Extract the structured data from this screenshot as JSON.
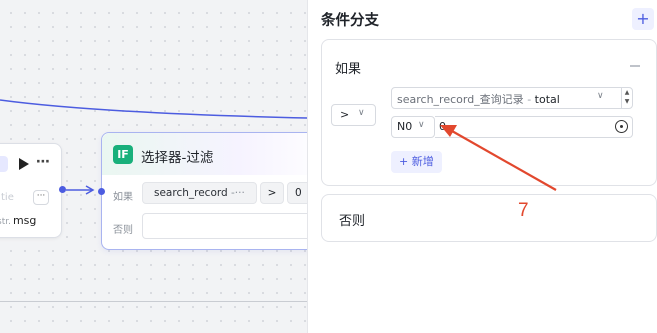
{
  "canvas": {
    "left_node": {
      "faint_label": "tie",
      "dots_button": "···",
      "output_type": "str.",
      "output_name": "msg"
    },
    "if_node": {
      "badge": "IF",
      "title": "选择器-过滤",
      "if_label": "如果",
      "field": "search_record",
      "field_suffix": "-···",
      "operator": ">",
      "value": "0",
      "else_label": "否则"
    }
  },
  "panel": {
    "title": "条件分支",
    "add_button": "+",
    "if_section": {
      "label": "如果",
      "operator": ">",
      "field_variable": "search_record_查询记录",
      "field_separator": "-",
      "field_property": "total",
      "value_type": "N0",
      "value": "0",
      "add_condition": "+ 新增"
    },
    "else_section": {
      "label": "否则"
    }
  },
  "annotation": {
    "number": "7",
    "color": "#e2482e"
  },
  "colors": {
    "accent": "#4c5ce0",
    "if_badge": "#18b07b"
  }
}
